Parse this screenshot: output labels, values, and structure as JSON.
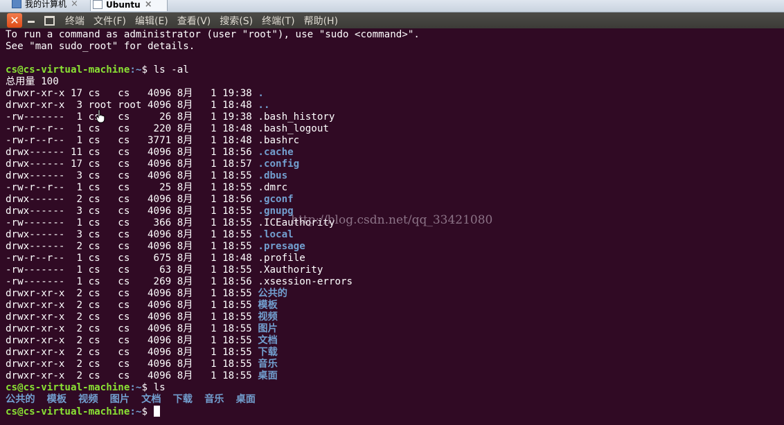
{
  "vm_tabs": [
    {
      "label": "我的计算机",
      "close": "×"
    },
    {
      "label": "Ubuntu",
      "close": "×"
    }
  ],
  "titlebar": {
    "close_glyph": "✕",
    "menu": [
      "终端",
      "文件(F)",
      "编辑(E)",
      "查看(V)",
      "搜索(S)",
      "终端(T)",
      "帮助(H)"
    ]
  },
  "terminal": {
    "intro": [
      "To run a command as administrator (user \"root\"), use \"sudo <command>\".",
      "See \"man sudo_root\" for details."
    ],
    "prompt_user": "cs@cs-virtual-machine",
    "prompt_path": ":~",
    "prompt_suffix": "$ ",
    "command1": "ls -al",
    "total": "总用量 100",
    "listing": [
      {
        "info": "drwxr-xr-x 17 cs   cs   4096 8月   1 19:38 ",
        "name": ".",
        "dir": true
      },
      {
        "info": "drwxr-xr-x  3 root root 4096 8月   1 18:48 ",
        "name": "..",
        "dir": true
      },
      {
        "info": "-rw-------  1 cs   cs     26 8月   1 19:38 ",
        "name": ".bash_history",
        "dir": false
      },
      {
        "info": "-rw-r--r--  1 cs   cs    220 8月   1 18:48 ",
        "name": ".bash_logout",
        "dir": false
      },
      {
        "info": "-rw-r--r--  1 cs   cs   3771 8月   1 18:48 ",
        "name": ".bashrc",
        "dir": false
      },
      {
        "info": "drwx------ 11 cs   cs   4096 8月   1 18:56 ",
        "name": ".cache",
        "dir": true
      },
      {
        "info": "drwx------ 17 cs   cs   4096 8月   1 18:57 ",
        "name": ".config",
        "dir": true
      },
      {
        "info": "drwx------  3 cs   cs   4096 8月   1 18:55 ",
        "name": ".dbus",
        "dir": true
      },
      {
        "info": "-rw-r--r--  1 cs   cs     25 8月   1 18:55 ",
        "name": ".dmrc",
        "dir": false
      },
      {
        "info": "drwx------  2 cs   cs   4096 8月   1 18:56 ",
        "name": ".gconf",
        "dir": true
      },
      {
        "info": "drwx------  3 cs   cs   4096 8月   1 18:55 ",
        "name": ".gnupg",
        "dir": true
      },
      {
        "info": "-rw-------  1 cs   cs    366 8月   1 18:55 ",
        "name": ".ICEauthority",
        "dir": false
      },
      {
        "info": "drwx------  3 cs   cs   4096 8月   1 18:55 ",
        "name": ".local",
        "dir": true
      },
      {
        "info": "drwx------  2 cs   cs   4096 8月   1 18:55 ",
        "name": ".presage",
        "dir": true
      },
      {
        "info": "-rw-r--r--  1 cs   cs    675 8月   1 18:48 ",
        "name": ".profile",
        "dir": false
      },
      {
        "info": "-rw-------  1 cs   cs     63 8月   1 18:55 ",
        "name": ".Xauthority",
        "dir": false
      },
      {
        "info": "-rw-------  1 cs   cs    269 8月   1 18:56 ",
        "name": ".xsession-errors",
        "dir": false
      },
      {
        "info": "drwxr-xr-x  2 cs   cs   4096 8月   1 18:55 ",
        "name": "公共的",
        "dir": true
      },
      {
        "info": "drwxr-xr-x  2 cs   cs   4096 8月   1 18:55 ",
        "name": "模板",
        "dir": true
      },
      {
        "info": "drwxr-xr-x  2 cs   cs   4096 8月   1 18:55 ",
        "name": "视频",
        "dir": true
      },
      {
        "info": "drwxr-xr-x  2 cs   cs   4096 8月   1 18:55 ",
        "name": "图片",
        "dir": true
      },
      {
        "info": "drwxr-xr-x  2 cs   cs   4096 8月   1 18:55 ",
        "name": "文档",
        "dir": true
      },
      {
        "info": "drwxr-xr-x  2 cs   cs   4096 8月   1 18:55 ",
        "name": "下载",
        "dir": true
      },
      {
        "info": "drwxr-xr-x  2 cs   cs   4096 8月   1 18:55 ",
        "name": "音乐",
        "dir": true
      },
      {
        "info": "drwxr-xr-x  2 cs   cs   4096 8月   1 18:55 ",
        "name": "桌面",
        "dir": true
      }
    ],
    "command2": "ls",
    "ls_output": [
      "公共的",
      "模板",
      "视频",
      "图片",
      "文档",
      "下载",
      "音乐",
      "桌面"
    ]
  },
  "watermark": "http://blog.csdn.net/qq_33421080",
  "colors": {
    "background": "#300a24",
    "text": "#ffffff",
    "prompt_user": "#8ae234",
    "directory": "#729fcf",
    "close_button": "#df4a16",
    "menubar": "#3c3b37"
  },
  "icons": [
    "computer-icon",
    "vm-icon",
    "close-icon",
    "minimize-icon",
    "maximize-icon",
    "mouse-pointer-icon"
  ]
}
